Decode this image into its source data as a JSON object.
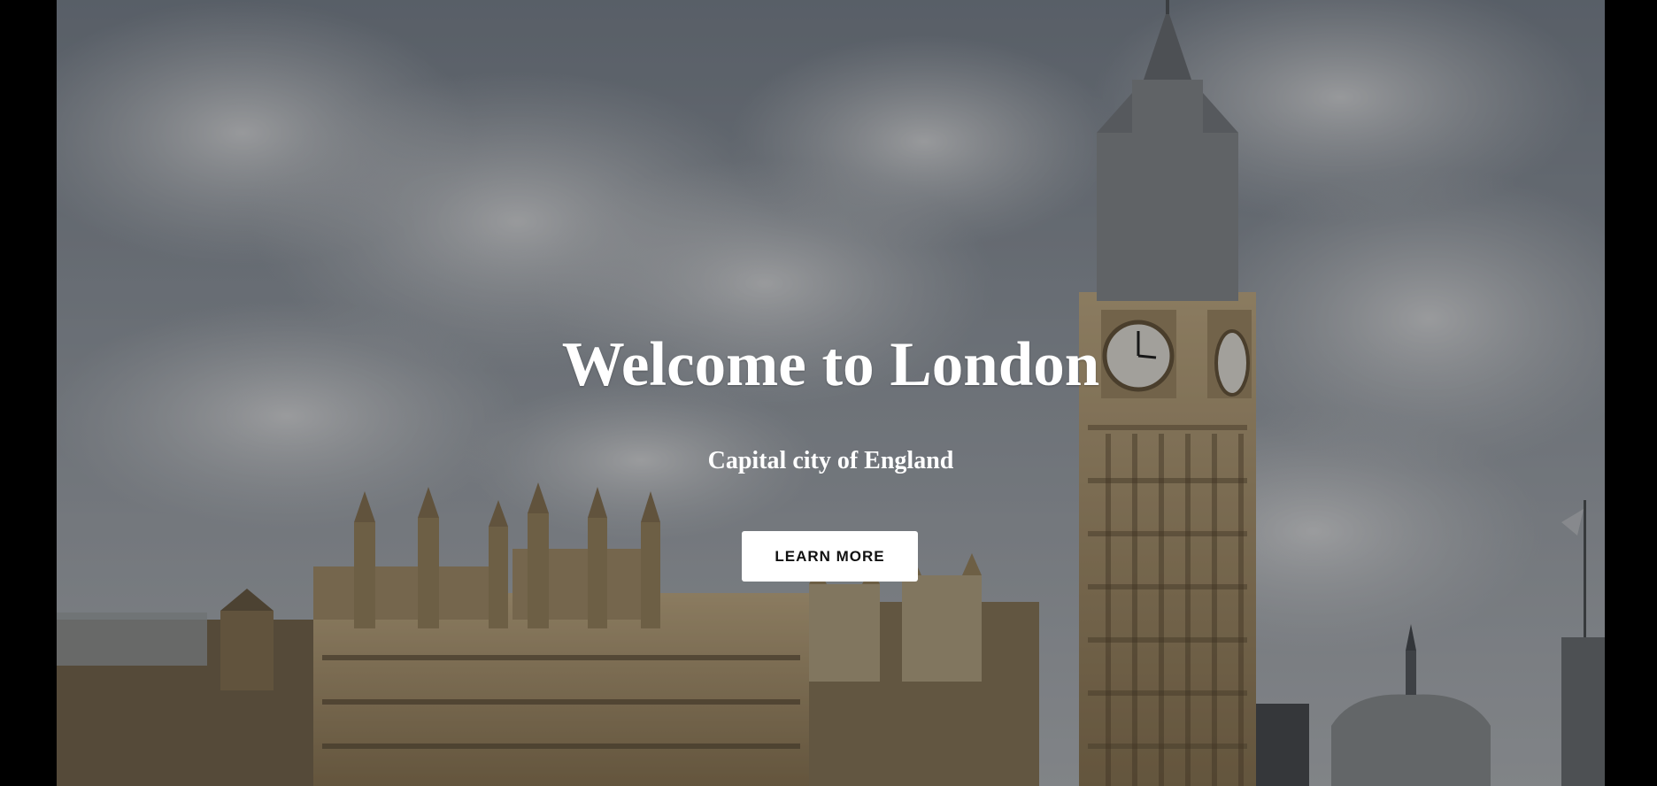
{
  "hero": {
    "title": "Welcome to London",
    "subtitle": "Capital city of England",
    "button_label": "LEARN MORE"
  },
  "colors": {
    "overlay": "rgba(0,0,0,0.30)",
    "text": "#ffffff",
    "button_bg": "#ffffff",
    "button_text": "#111111",
    "stone": "#b9a27c",
    "sky": "#8a9099"
  },
  "background": {
    "image": "hero-photo-london",
    "depicts": [
      "clouds",
      "palace-of-westminster",
      "clock-tower"
    ]
  }
}
